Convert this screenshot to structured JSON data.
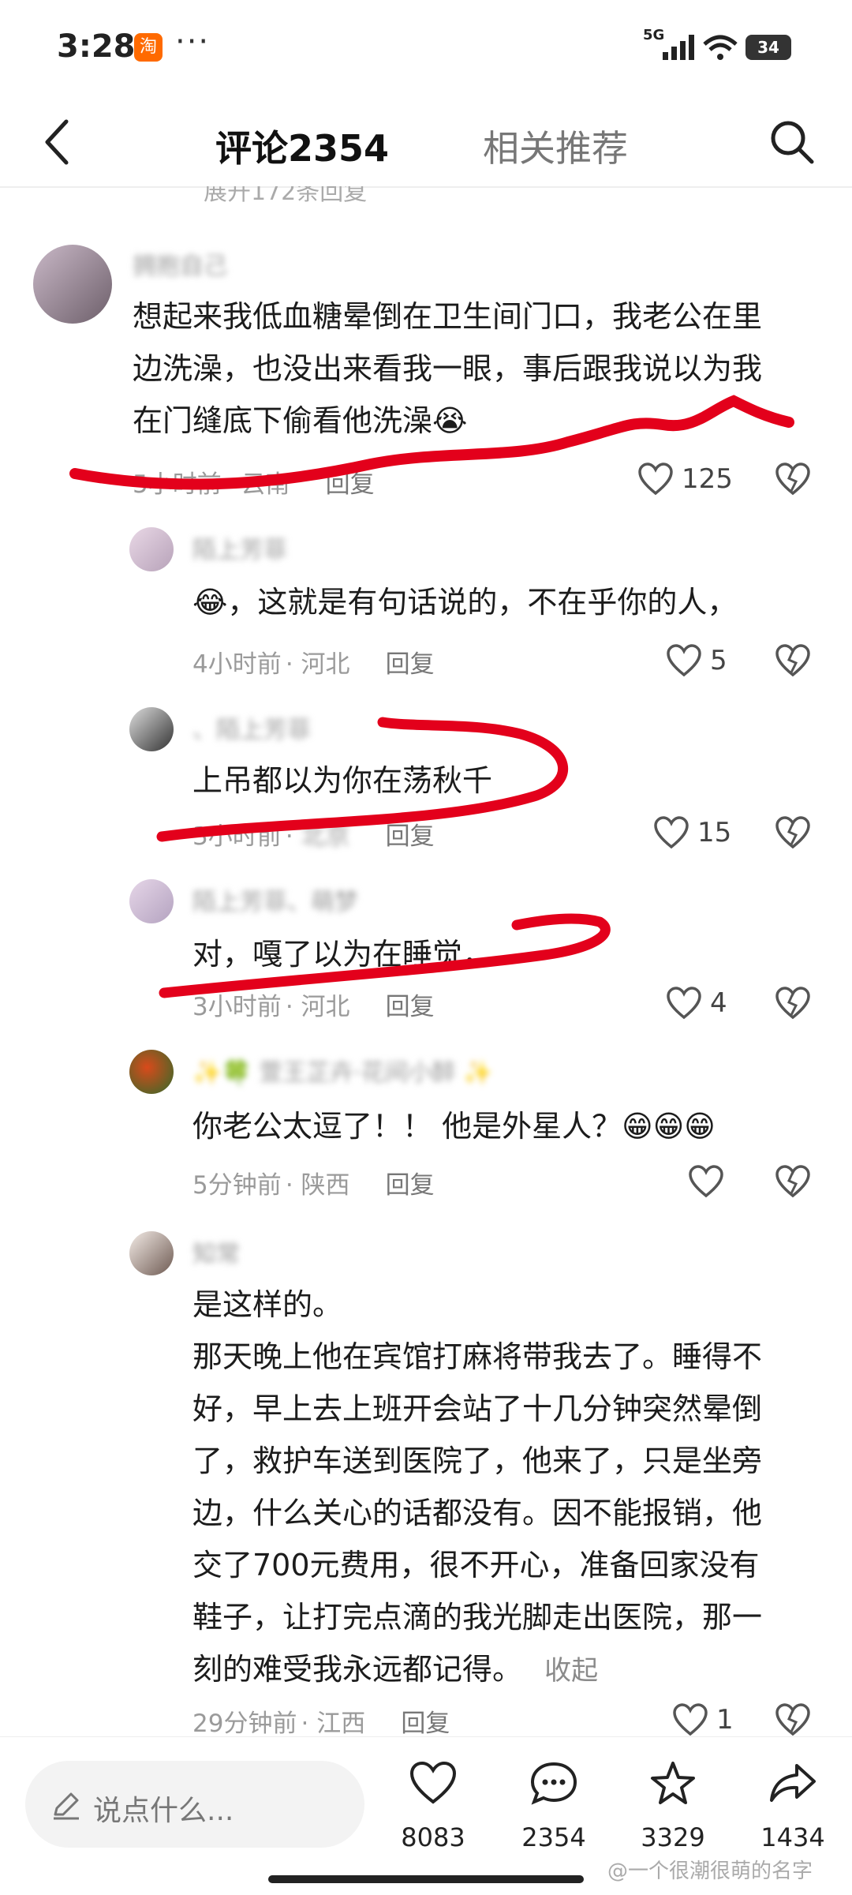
{
  "status_bar": {
    "time": "3:28",
    "app_badge": "淘",
    "network": "5G",
    "battery": "34"
  },
  "header": {
    "tab_comments": "评论2354",
    "tab_related": "相关推荐"
  },
  "expand_hint": "展开172条回复",
  "comments": [
    {
      "username": "拥抱自己",
      "text_lines": [
        "想起来我低血糖晕倒在卫生间门口，我老公在里",
        "边洗澡，也没出来看我一眼，事后跟我说以为我",
        "在门缝底下偷看他洗澡😭"
      ],
      "time": "5小时前",
      "location": "云南",
      "reply": "回复",
      "likes": "125"
    },
    {
      "username": "陌上芳菲",
      "text": "😂，这就是有句话说的，不在乎你的人，",
      "time": "4小时前",
      "location": "河北",
      "reply": "回复",
      "likes": "5"
    },
    {
      "username": "、陌上芳菲",
      "text": "上吊都以为你在荡秋千",
      "time": "3小时前",
      "location": "北京",
      "reply": "回复",
      "likes": "15"
    },
    {
      "username": "陌上芳菲、萌梦",
      "text": "对，嘎了以为在睡觉，",
      "time": "3小时前",
      "location": "河北",
      "reply": "回复",
      "likes": "4"
    },
    {
      "username": "✨🍀 萱王芷卉·花间小醉 ✨",
      "text": "你老公太逗了！！ 他是外星人？😁😁😁",
      "time": "5分钟前",
      "location": "陕西",
      "reply": "回复",
      "likes": ""
    },
    {
      "username": "知常",
      "text_lines": [
        "是这样的。",
        "那天晚上他在宾馆打麻将带我去了。睡得不",
        "好，早上去上班开会站了十几分钟突然晕倒",
        "了，救护车送到医院了，他来了，只是坐旁",
        "边，什么关心的话都没有。因不能报销，他",
        "交了700元费用，很不开心，准备回家没有",
        "鞋子，让打完点滴的我光脚走出医院，那一"
      ],
      "last_line": "刻的难受我永远都记得。",
      "collapse": "收起",
      "time": "29分钟前",
      "location": "江西",
      "reply": "回复",
      "likes": "1"
    }
  ],
  "bottom_bar": {
    "input_placeholder": "说点什么...",
    "likes": "8083",
    "comments": "2354",
    "favorites": "3329",
    "shares": "1434"
  },
  "watermark": "@一个很潮很萌的名字",
  "colors": {
    "annotation_red": "#e3001b",
    "accent_orange": "#ff6a00"
  }
}
